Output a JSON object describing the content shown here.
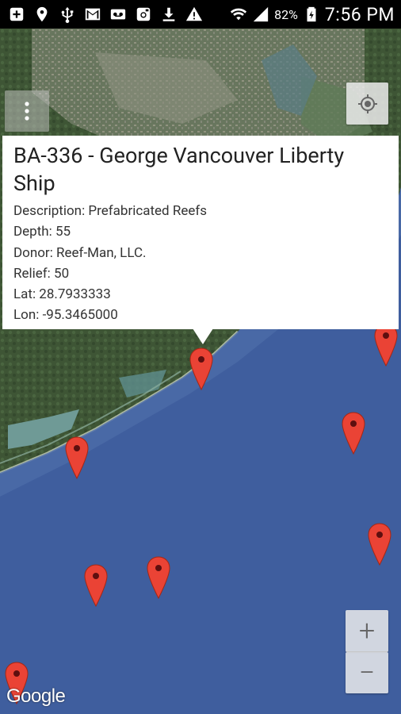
{
  "status_bar": {
    "icons": [
      "notification-plus-icon",
      "location-pin-icon",
      "usb-icon",
      "gmail-icon",
      "voicemail-icon",
      "instagram-icon",
      "download-icon",
      "warning-icon",
      "wifi-icon",
      "signal-icon",
      "battery-icon"
    ],
    "battery": "82%",
    "time": "7:56 PM"
  },
  "map": {
    "zoom_in_label": "+",
    "zoom_out_label": "−",
    "attribution": "Google"
  },
  "info_window": {
    "title": "BA-336 - George Vancouver Liberty Ship",
    "fields": [
      "Description: Prefabricated Reefs",
      "Depth: 55",
      "Donor: Reef-Man, LLC.",
      "Relief: 50",
      "Lat: 28.7933333",
      "Lon: -95.3465000"
    ]
  },
  "colors": {
    "ocean": "#3f5e9e",
    "marker": "#ea4335"
  }
}
